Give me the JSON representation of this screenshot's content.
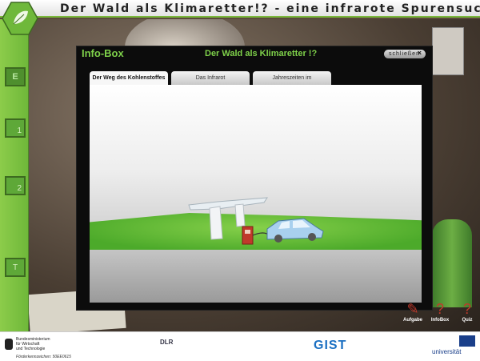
{
  "app": {
    "title": "Der Wald als Klimaretter!? - eine infrarote Spurensuche"
  },
  "sidebar": {
    "buttons": [
      {
        "label": "E"
      },
      {
        "label": "1"
      },
      {
        "label": "2"
      },
      {
        "label": "T"
      }
    ]
  },
  "infobox": {
    "label": "Info-Box",
    "title": "Der Wald als Klimaretter !?",
    "close_label": "schließen",
    "close_icon": "×",
    "tabs": [
      {
        "label": "Der Weg des Kohlenstoffes",
        "active": true
      },
      {
        "label": "Das Infrarot",
        "active": false
      },
      {
        "label": "Jahreszeiten im",
        "active": false
      }
    ]
  },
  "tools": [
    {
      "label": "Aufgabe",
      "icon": "pencil-icon"
    },
    {
      "label": "InfoBox",
      "icon": "question-icon"
    },
    {
      "label": "Quiz",
      "icon": "lightbulb-icon"
    }
  ],
  "footer": {
    "bmwi_line1": "Bundesministerium",
    "bmwi_line2": "für Wirtschaft",
    "bmwi_line3": "und Technologie",
    "foerder": "Förderkennzeichen: 50EE0615",
    "dlr": "DLR",
    "uni": "universität"
  },
  "colors": {
    "accent_green": "#7ed04a",
    "sidebar_green": "#6fb83a"
  }
}
